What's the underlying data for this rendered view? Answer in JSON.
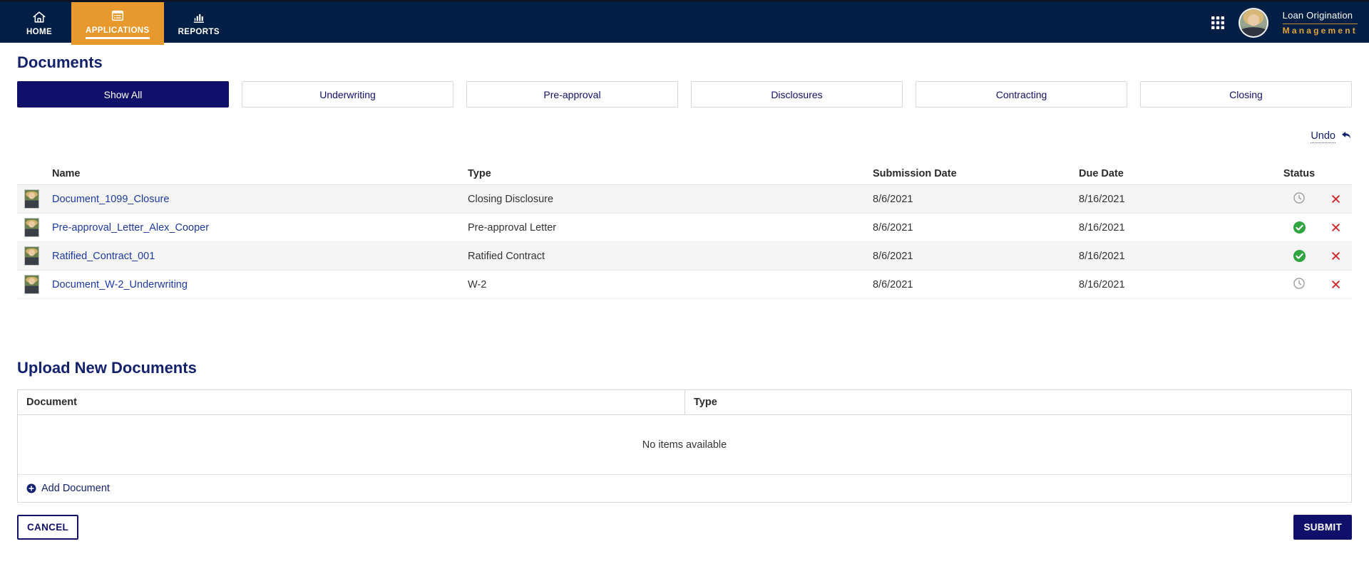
{
  "colors": {
    "navy": "#011E44",
    "orange": "#E8992D",
    "brand": "#10106B",
    "heading": "#14216B",
    "link": "#1E3AA0",
    "green": "#2FA441",
    "red": "#CE2B2B"
  },
  "nav": {
    "tabs": [
      {
        "label": "HOME",
        "icon": "home-icon",
        "active": false
      },
      {
        "label": "APPLICATIONS",
        "icon": "applications-icon",
        "active": true
      },
      {
        "label": "REPORTS",
        "icon": "reports-icon",
        "active": false
      }
    ],
    "logo": {
      "line1": "Loan Origination",
      "line2": "Management"
    }
  },
  "documents": {
    "title": "Documents",
    "filters": [
      {
        "label": "Show All",
        "selected": true
      },
      {
        "label": "Underwriting",
        "selected": false
      },
      {
        "label": "Pre-approval",
        "selected": false
      },
      {
        "label": "Disclosures",
        "selected": false
      },
      {
        "label": "Contracting",
        "selected": false
      },
      {
        "label": "Closing",
        "selected": false
      }
    ],
    "undo_label": "Undo",
    "table": {
      "headers": {
        "name": "Name",
        "type": "Type",
        "submission": "Submission Date",
        "due": "Due Date",
        "status": "Status"
      },
      "rows": [
        {
          "name": "Document_1099_Closure",
          "type": "Closing Disclosure",
          "submission": "8/6/2021",
          "due": "8/16/2021",
          "status": "pending"
        },
        {
          "name": "Pre-approval_Letter_Alex_Cooper",
          "type": "Pre-approval Letter",
          "submission": "8/6/2021",
          "due": "8/16/2021",
          "status": "approved"
        },
        {
          "name": "Ratified_Contract_001",
          "type": "Ratified Contract",
          "submission": "8/6/2021",
          "due": "8/16/2021",
          "status": "approved"
        },
        {
          "name": "Document_W-2_Underwriting",
          "type": "W-2",
          "submission": "8/6/2021",
          "due": "8/16/2021",
          "status": "pending"
        }
      ]
    }
  },
  "upload": {
    "title": "Upload New Documents",
    "headers": {
      "document": "Document",
      "type": "Type"
    },
    "empty_message": "No items available",
    "add_label": "Add Document"
  },
  "actions": {
    "cancel": "CANCEL",
    "submit": "SUBMIT"
  }
}
